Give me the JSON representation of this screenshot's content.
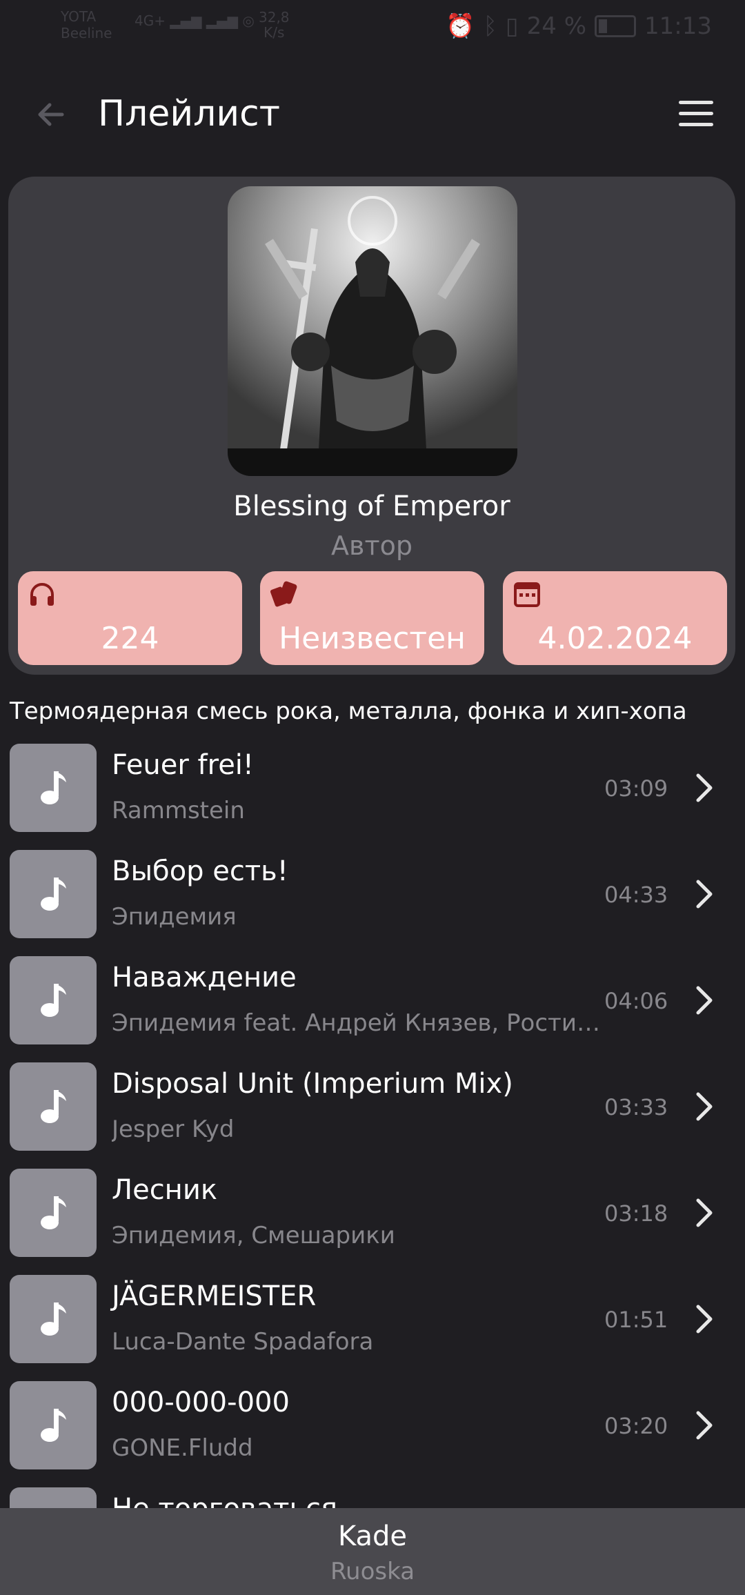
{
  "status_bar": {
    "carrier1": "YOTA",
    "carrier2": "Beeline",
    "net_type": "4G+",
    "speed_value": "32,8",
    "speed_unit": "K/s",
    "battery": "24 %",
    "time": "11:13"
  },
  "header": {
    "title": "Плейлист"
  },
  "playlist": {
    "name": "Blessing of Emperor",
    "author": "Автор",
    "stats": [
      {
        "icon": "headphones-icon",
        "value": "224"
      },
      {
        "icon": "cards-icon",
        "value": "Неизвестен"
      },
      {
        "icon": "calendar-icon",
        "value": "4.02.2024"
      }
    ],
    "description": "Термоядерная смесь рока, металла, фонка и хип-хопа"
  },
  "tracks": [
    {
      "title": "Feuer frei!",
      "artist": "Rammstein",
      "duration": "03:09"
    },
    {
      "title": "Выбор есть!",
      "artist": "Эпидемия",
      "duration": "04:33"
    },
    {
      "title": "Наваждение",
      "artist": "Эпидемия feat. Андрей Князев, Ростислав",
      "duration": "04:06"
    },
    {
      "title": "Disposal Unit (Imperium Mix)",
      "artist": "Jesper Kyd",
      "duration": "03:33"
    },
    {
      "title": "Лесник",
      "artist": "Эпидемия, Смешарики",
      "duration": "03:18"
    },
    {
      "title": "JÄGERMEISTER",
      "artist": "Luca-Dante Spadafora",
      "duration": "01:51"
    },
    {
      "title": "000-000-000",
      "artist": "GONE.Fludd",
      "duration": "03:20"
    },
    {
      "title": "Не торговаться",
      "artist": "",
      "duration": ""
    }
  ],
  "player": {
    "title": "Kade",
    "artist": "Ruoska"
  },
  "colors": {
    "background": "#1f1e22",
    "card": "#3d3c41",
    "stat_bg": "#f0b3b0",
    "stat_icon": "#8a1a1a",
    "thumb": "#8f8e96"
  }
}
